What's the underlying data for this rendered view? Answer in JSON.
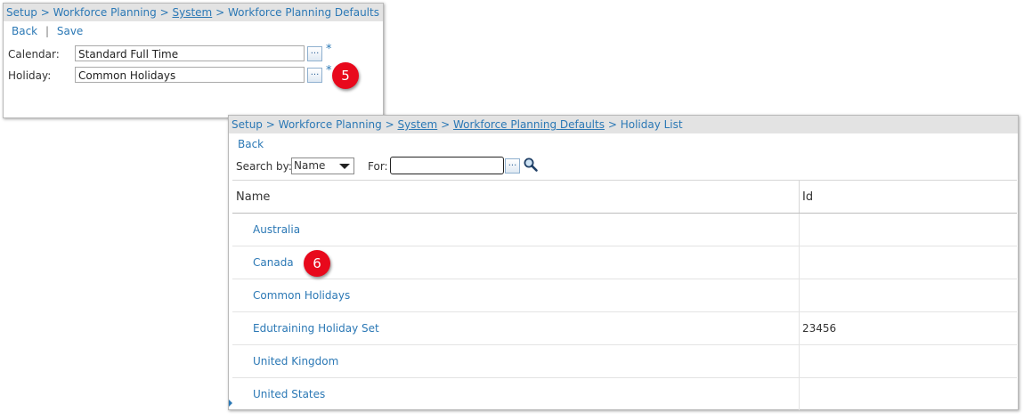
{
  "defaults_window": {
    "breadcrumb": {
      "setup": "Setup",
      "sep1": ">",
      "workforce_planning": "Workforce Planning",
      "sep2": ">",
      "system": "System",
      "sep3": ">",
      "current": "Workforce Planning Defaults"
    },
    "actions": {
      "back": "Back",
      "separator": "|",
      "save": "Save"
    },
    "fields": {
      "calendar": {
        "label": "Calendar:",
        "value": "Standard Full Time",
        "browse": "...",
        "required": "*"
      },
      "holiday": {
        "label": "Holiday:",
        "value": "Common Holidays",
        "browse": "...",
        "required": "*"
      }
    },
    "step_marker": "5"
  },
  "holiday_list_window": {
    "breadcrumb": {
      "setup": "Setup",
      "sep1": ">",
      "workforce_planning": "Workforce Planning",
      "sep2": ">",
      "system": "System",
      "sep3": ">",
      "defaults": "Workforce Planning Defaults",
      "sep4": ">",
      "current": "Holiday List"
    },
    "back": "Back",
    "search": {
      "label": "Search by:",
      "selected": "Name",
      "for_label": "For:",
      "for_value": "",
      "browse": "..."
    },
    "columns": {
      "name": "Name",
      "id": "Id"
    },
    "rows": [
      {
        "name": "Australia",
        "id": ""
      },
      {
        "name": "Canada",
        "id": ""
      },
      {
        "name": "Common Holidays",
        "id": ""
      },
      {
        "name": "Edutraining Holiday Set",
        "id": "23456"
      },
      {
        "name": "United Kingdom",
        "id": ""
      },
      {
        "name": "United States",
        "id": ""
      }
    ],
    "step_marker": "6"
  },
  "colors": {
    "link": "#2b78b5",
    "step_marker": "#e8091c",
    "breadcrumb_bg": "#e3e3e3"
  }
}
